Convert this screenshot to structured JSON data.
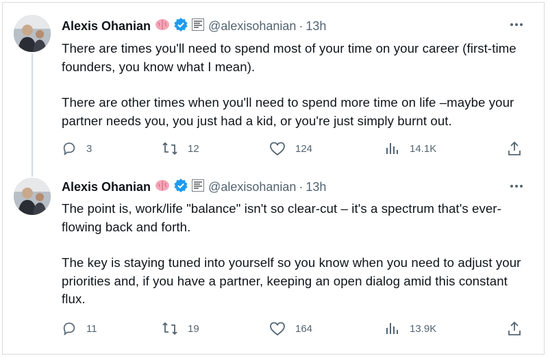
{
  "tweets": [
    {
      "author": {
        "name": "Alexis Ohanian",
        "handle": "@alexisohanian",
        "time": "13h"
      },
      "paragraphs": [
        "There are times you'll need to spend most of your time on your career (first-time founders, you know what I mean).",
        "There are other times when you'll need to spend more time on life –maybe your partner needs you, you just had a kid, or you're just simply burnt out."
      ],
      "stats": {
        "replies": "3",
        "retweets": "12",
        "likes": "124",
        "views": "14.1K"
      }
    },
    {
      "author": {
        "name": "Alexis Ohanian",
        "handle": "@alexisohanian",
        "time": "13h"
      },
      "paragraphs": [
        "The point is, work/life \"balance\" isn't so clear-cut – it's a spectrum that's ever-flowing back and forth.",
        "The key is staying tuned into yourself so you know when you need to adjust your priorities and, if you have a partner, keeping an open dialog amid this constant flux."
      ],
      "stats": {
        "replies": "11",
        "retweets": "19",
        "likes": "164",
        "views": "13.9K"
      }
    }
  ],
  "icons": [
    "brain-emoji-icon",
    "verified-badge-icon",
    "affiliate-badge-icon",
    "more-icon",
    "reply-icon",
    "retweet-icon",
    "like-icon",
    "views-icon",
    "share-icon"
  ],
  "colors": {
    "verified": "#1d9bf0",
    "muted": "#536471",
    "text": "#0f1419",
    "thread_line": "#cfd9de"
  }
}
